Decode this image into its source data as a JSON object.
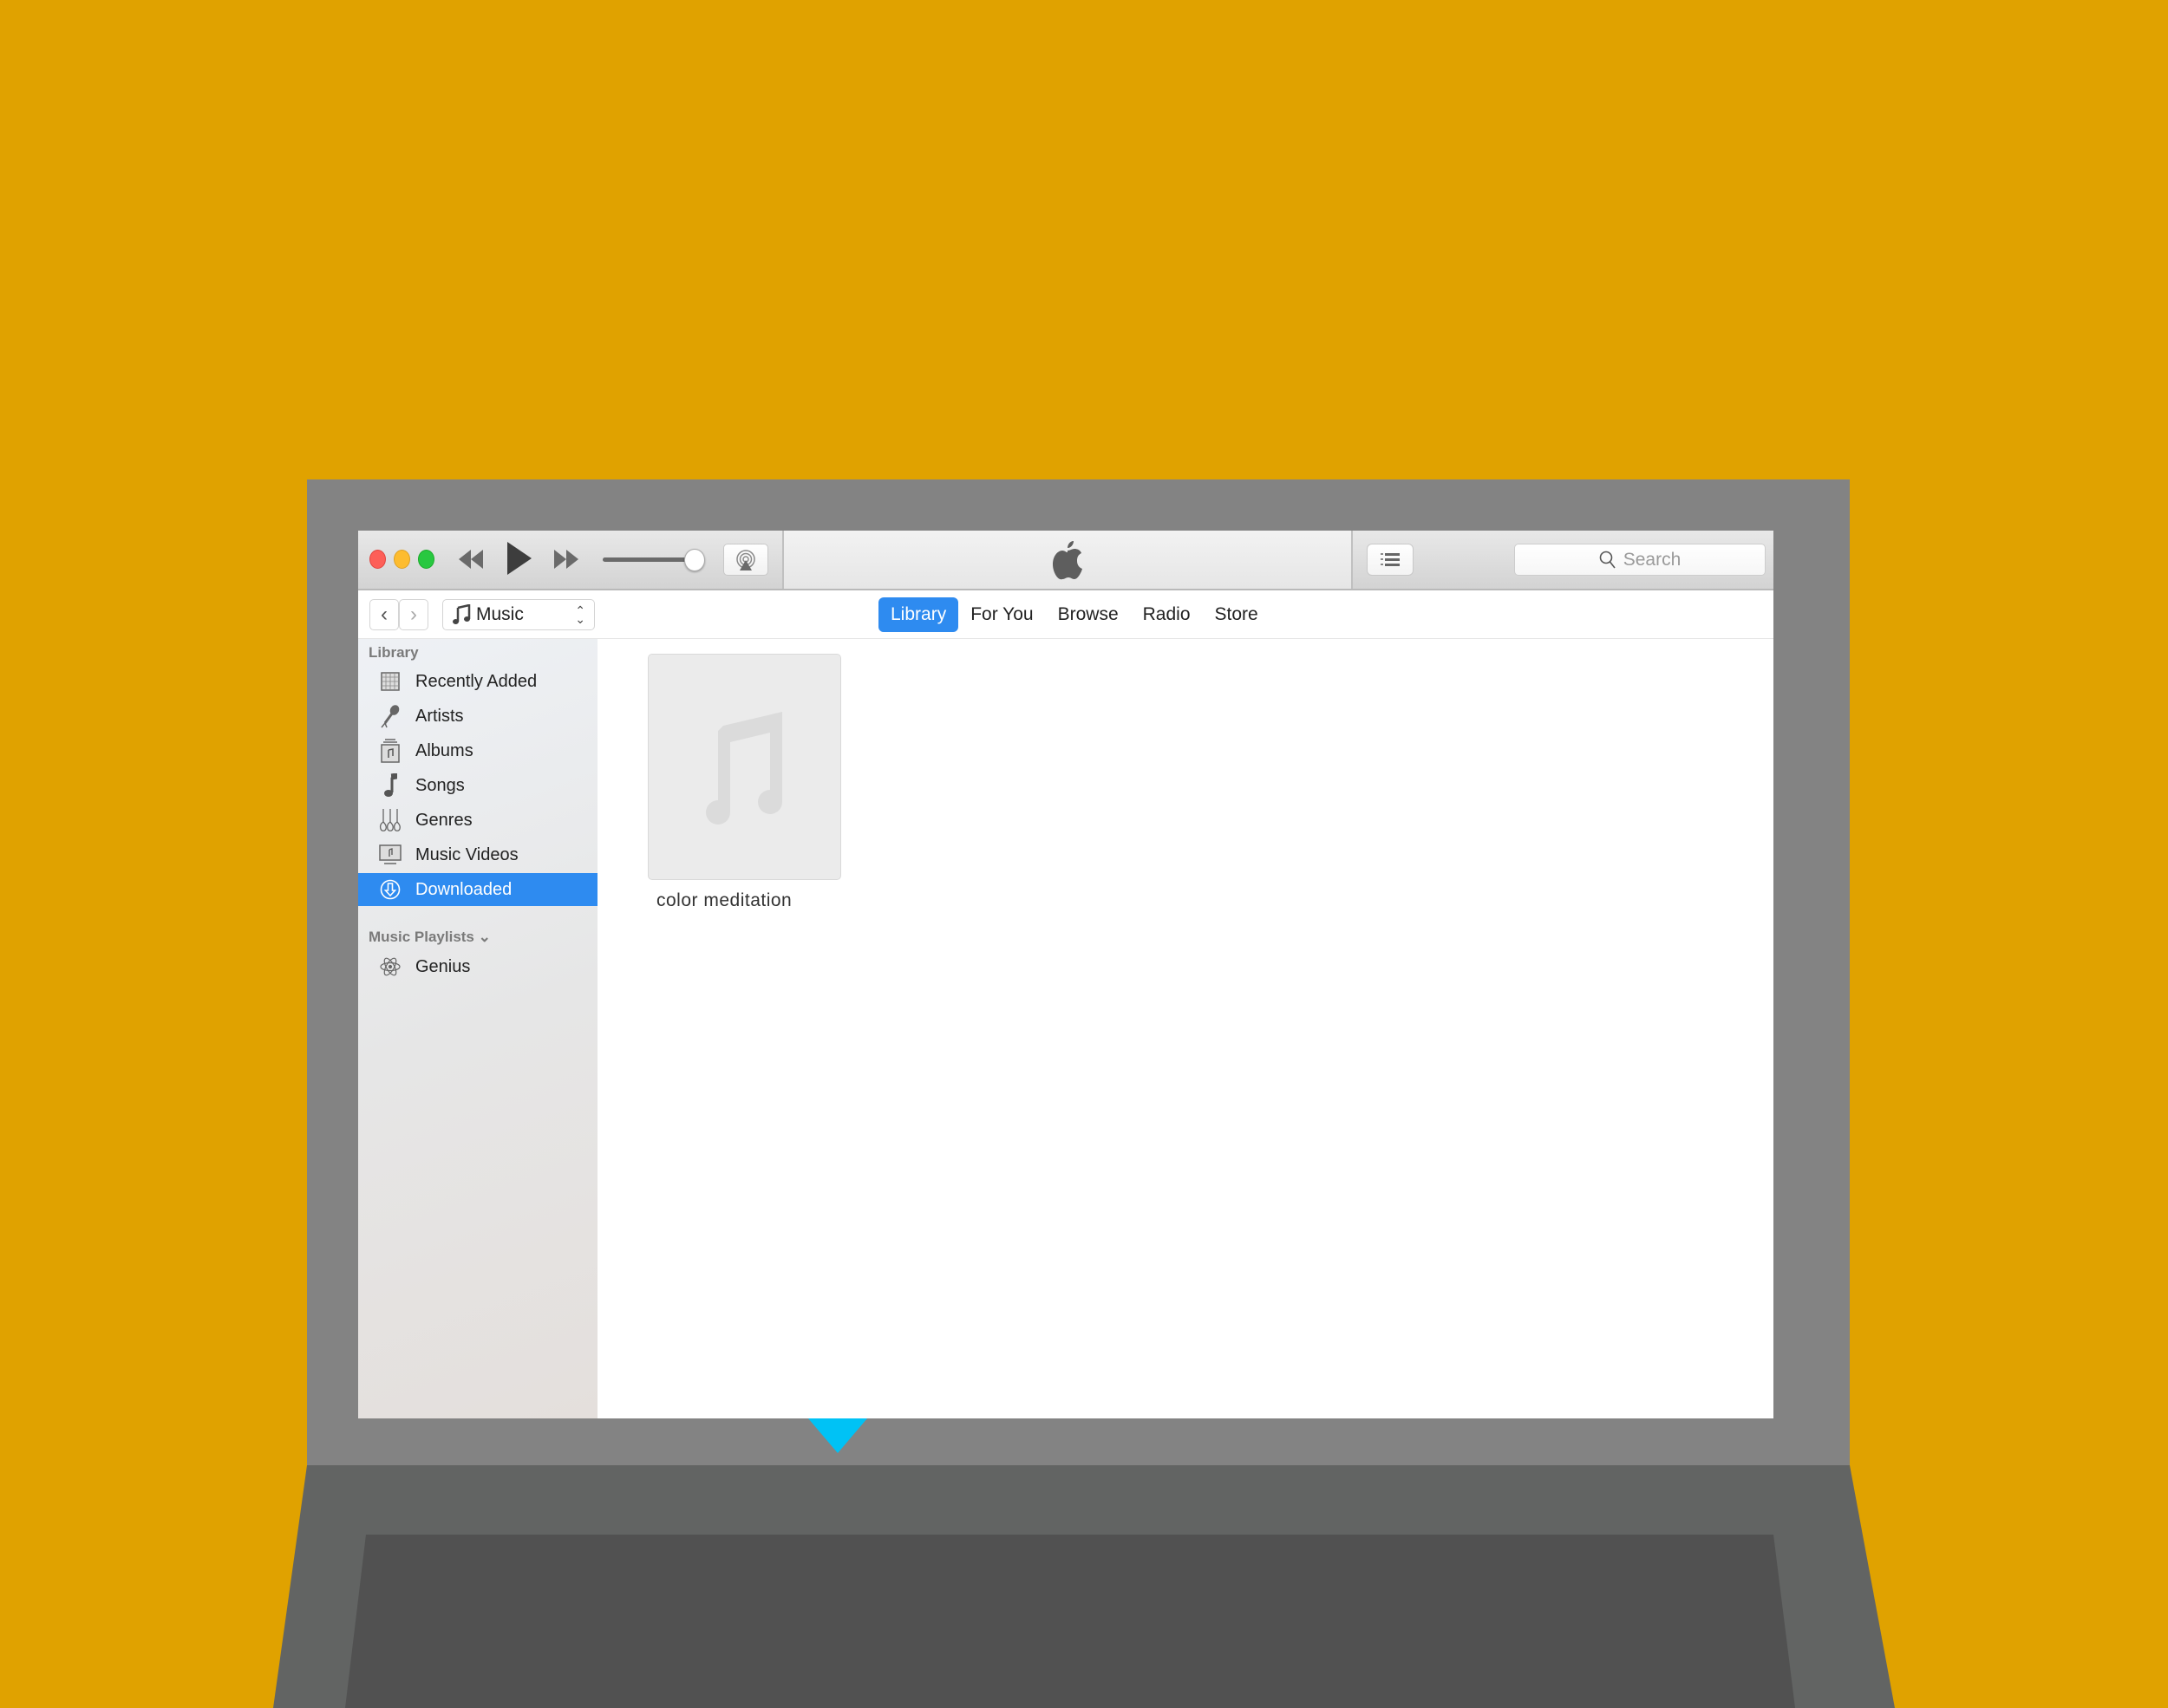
{
  "colors": {
    "background": "#E0A200",
    "bezel": "#838383",
    "base": "#626463",
    "base_inner": "#515151",
    "accent": "#2E8BF0",
    "indicator": "#00C2F5"
  },
  "toolbar": {
    "traffic_lights": [
      "close",
      "minimize",
      "maximize"
    ],
    "prev_icon": "rewind-icon",
    "play_icon": "play-icon",
    "next_icon": "fast-forward-icon",
    "volume_level": 1.0,
    "airplay_icon": "airplay-icon",
    "center_logo": "apple-logo-icon",
    "list_icon": "numbered-list-icon",
    "search_placeholder": "Search"
  },
  "navbar": {
    "back_glyph": "‹",
    "forward_glyph": "›",
    "media_type": "Music",
    "tabs": [
      {
        "label": "Library",
        "active": true
      },
      {
        "label": "For You",
        "active": false
      },
      {
        "label": "Browse",
        "active": false
      },
      {
        "label": "Radio",
        "active": false
      },
      {
        "label": "Store",
        "active": false
      }
    ]
  },
  "sidebar": {
    "library_heading": "Library",
    "items": [
      {
        "label": "Recently Added",
        "icon": "grid-calendar-icon",
        "selected": false
      },
      {
        "label": "Artists",
        "icon": "microphone-icon",
        "selected": false
      },
      {
        "label": "Albums",
        "icon": "album-icon",
        "selected": false
      },
      {
        "label": "Songs",
        "icon": "music-note-icon",
        "selected": false
      },
      {
        "label": "Genres",
        "icon": "guitars-icon",
        "selected": false
      },
      {
        "label": "Music Videos",
        "icon": "music-video-icon",
        "selected": false
      },
      {
        "label": "Downloaded",
        "icon": "download-circle-icon",
        "selected": true
      }
    ],
    "playlists_heading": "Music Playlists",
    "playlists_chevron": "⌄",
    "playlists": [
      {
        "label": "Genius",
        "icon": "atom-icon"
      }
    ]
  },
  "content": {
    "albums": [
      {
        "title": "color meditation",
        "artwork": "music-note-placeholder-icon"
      }
    ]
  }
}
